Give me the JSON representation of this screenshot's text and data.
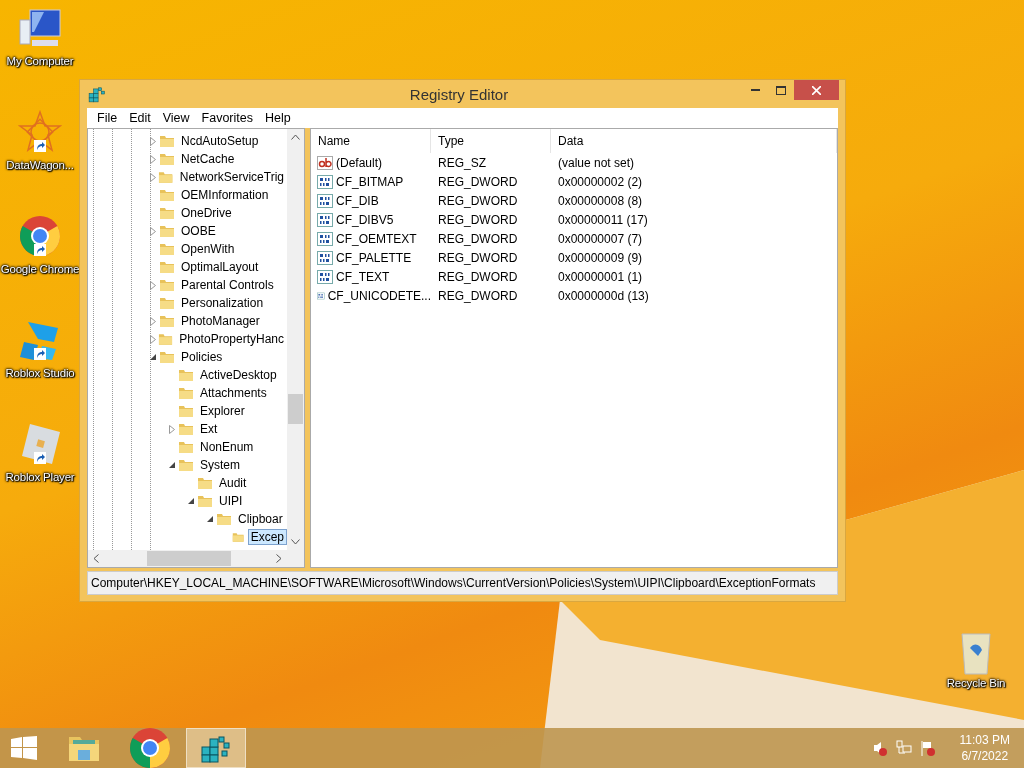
{
  "desktop_icons": [
    {
      "label": "My Computer",
      "kind": "computer",
      "shortcut": false
    },
    {
      "label": "DataWagon...",
      "kind": "star",
      "shortcut": true
    },
    {
      "label": "Google Chrome",
      "kind": "chrome",
      "shortcut": true
    },
    {
      "label": "Roblox Studio",
      "kind": "studio",
      "shortcut": true
    },
    {
      "label": "Roblox Player",
      "kind": "player",
      "shortcut": true
    }
  ],
  "recycle_bin": {
    "label": "Recycle Bin"
  },
  "window": {
    "title": "Registry Editor",
    "menu": [
      "File",
      "Edit",
      "View",
      "Favorites",
      "Help"
    ],
    "tree": [
      {
        "label": "NcdAutoSetup",
        "expandable": true,
        "expanded": false,
        "selected": false
      },
      {
        "label": "NetCache",
        "expandable": true,
        "expanded": false,
        "selected": false
      },
      {
        "label": "NetworkServiceTrig",
        "expandable": true,
        "expanded": false,
        "selected": false
      },
      {
        "label": "OEMInformation",
        "expandable": false,
        "selected": false
      },
      {
        "label": "OneDrive",
        "expandable": false,
        "selected": false
      },
      {
        "label": "OOBE",
        "expandable": true,
        "expanded": false,
        "selected": false
      },
      {
        "label": "OpenWith",
        "expandable": false,
        "selected": false
      },
      {
        "label": "OptimalLayout",
        "expandable": false,
        "selected": false
      },
      {
        "label": "Parental Controls",
        "expandable": true,
        "expanded": false,
        "selected": false
      },
      {
        "label": "Personalization",
        "expandable": false,
        "selected": false
      },
      {
        "label": "PhotoManager",
        "expandable": true,
        "expanded": false,
        "selected": false
      },
      {
        "label": "PhotoPropertyHanc",
        "expandable": true,
        "expanded": false,
        "selected": false
      },
      {
        "label": "Policies",
        "expandable": true,
        "expanded": true,
        "selected": false,
        "children": [
          {
            "label": "ActiveDesktop",
            "expandable": false,
            "selected": false
          },
          {
            "label": "Attachments",
            "expandable": false,
            "selected": false
          },
          {
            "label": "Explorer",
            "expandable": false,
            "selected": false
          },
          {
            "label": "Ext",
            "expandable": true,
            "expanded": false,
            "selected": false
          },
          {
            "label": "NonEnum",
            "expandable": false,
            "selected": false
          },
          {
            "label": "System",
            "expandable": true,
            "expanded": true,
            "selected": false,
            "children": [
              {
                "label": "Audit",
                "expandable": false,
                "selected": false
              },
              {
                "label": "UIPI",
                "expandable": true,
                "expanded": true,
                "selected": false,
                "children": [
                  {
                    "label": "Clipboar",
                    "expandable": true,
                    "expanded": true,
                    "selected": false,
                    "children": [
                      {
                        "label": "Excep",
                        "expandable": false,
                        "selected": true
                      }
                    ]
                  }
                ]
              }
            ]
          }
        ]
      }
    ],
    "columns": [
      "Name",
      "Type",
      "Data"
    ],
    "values": [
      {
        "kind": "string",
        "name": "(Default)",
        "type": "REG_SZ",
        "data": "(value not set)"
      },
      {
        "kind": "dword",
        "name": "CF_BITMAP",
        "type": "REG_DWORD",
        "data": "0x00000002 (2)"
      },
      {
        "kind": "dword",
        "name": "CF_DIB",
        "type": "REG_DWORD",
        "data": "0x00000008 (8)"
      },
      {
        "kind": "dword",
        "name": "CF_DIBV5",
        "type": "REG_DWORD",
        "data": "0x00000011 (17)"
      },
      {
        "kind": "dword",
        "name": "CF_OEMTEXT",
        "type": "REG_DWORD",
        "data": "0x00000007 (7)"
      },
      {
        "kind": "dword",
        "name": "CF_PALETTE",
        "type": "REG_DWORD",
        "data": "0x00000009 (9)"
      },
      {
        "kind": "dword",
        "name": "CF_TEXT",
        "type": "REG_DWORD",
        "data": "0x00000001 (1)"
      },
      {
        "kind": "dword",
        "name": "CF_UNICODETE...",
        "type": "REG_DWORD",
        "data": "0x0000000d (13)"
      }
    ],
    "status_bar": "Computer\\HKEY_LOCAL_MACHINE\\SOFTWARE\\Microsoft\\Windows\\CurrentVersion\\Policies\\System\\UIPI\\Clipboard\\ExceptionFormats"
  },
  "taskbar": {
    "apps": [
      {
        "kind": "explorer",
        "selected": false
      },
      {
        "kind": "chrome",
        "selected": false
      },
      {
        "kind": "regedit",
        "selected": true
      }
    ],
    "tray": [
      {
        "kind": "volume",
        "error": true
      },
      {
        "kind": "network",
        "error": false
      },
      {
        "kind": "flag",
        "error": true
      }
    ],
    "time": "11:03 PM",
    "date": "6/7/2022"
  }
}
